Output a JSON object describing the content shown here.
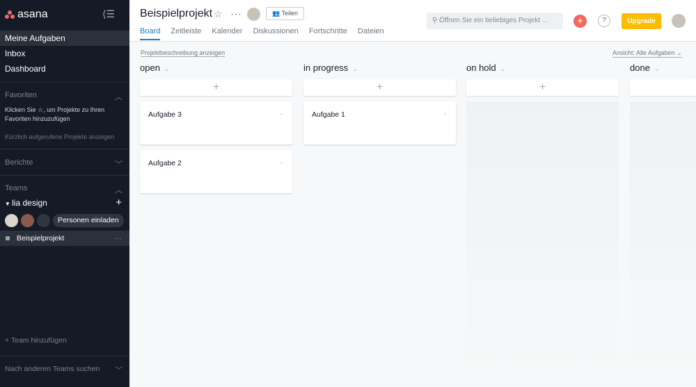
{
  "sidebar": {
    "logo": "asana",
    "nav": [
      "Meine Aufgaben",
      "Inbox",
      "Dashboard"
    ],
    "favorites": {
      "title": "Favoriten",
      "hint": "Klicken Sie ☆, um Projekte zu Ihren Favoriten hinzuzufügen",
      "recent": "Kürzlich aufgerufene Projekte anzeigen"
    },
    "reports": "Berichte",
    "teams": "Teams",
    "team_name": "lia design",
    "invite": "Personen einladen",
    "project": "Beispielprojekt",
    "add_team": "+ Team hinzufügen",
    "search_teams": "Nach anderen Teams suchen"
  },
  "header": {
    "title": "Beispielprojekt",
    "share": "Teilen",
    "tabs": [
      "Board",
      "Zeitleiste",
      "Kalender",
      "Diskussionen",
      "Fortschritte",
      "Dateien"
    ],
    "search_placeholder": "Öffnen Sie ein beliebiges Projekt ...",
    "help": "?",
    "upgrade": "Upgrade",
    "accent": "#1f7ab8"
  },
  "board": {
    "show_description": "Projektbeschreibung anzeigen",
    "view": "Ansicht: Alle Aufgaben",
    "columns": [
      {
        "name": "open",
        "cards": [
          "Aufgabe 3",
          "Aufgabe 2"
        ]
      },
      {
        "name": "in progress",
        "cards": [
          "Aufgabe 1"
        ]
      },
      {
        "name": "on hold",
        "cards": []
      },
      {
        "name": "done",
        "cards": []
      }
    ]
  }
}
